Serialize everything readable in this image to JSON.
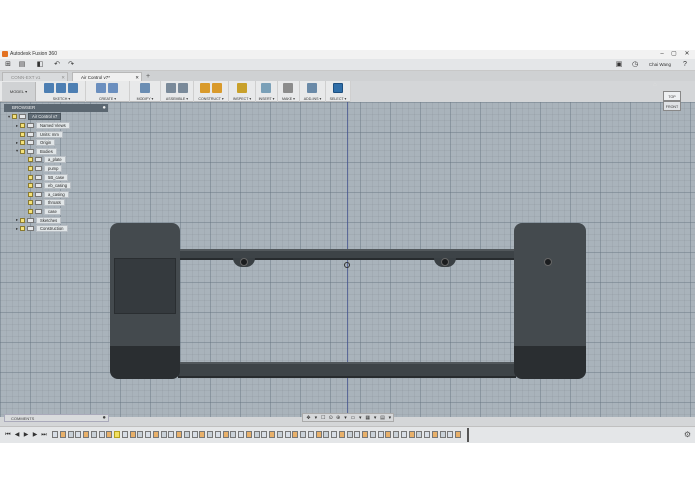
{
  "app": {
    "title": "Autodesk Fusion 360"
  },
  "window_controls": {
    "minimize": "–",
    "maximize": "▢",
    "close": "✕"
  },
  "quick_access": {
    "grid_icon": "⊞",
    "file_icon": "▤",
    "save_icon": "◧",
    "undo_icon": "↶",
    "redo_icon": "↷",
    "user_name": "Chai Wang",
    "help_icon": "?"
  },
  "tabs": [
    {
      "label": "CONN-EXT v1",
      "close": "✕"
    },
    {
      "label": "Air Control v7*",
      "close": "✕"
    }
  ],
  "tab_add": "+",
  "toolbar": {
    "workspace": "MODEL ▾",
    "groups": [
      {
        "label": "SKETCH ▾",
        "color": "#4d7fb3"
      },
      {
        "label": "CREATE ▾",
        "color": "#6b8fbf"
      },
      {
        "label": "MODIFY ▾",
        "color": "#6a8db3"
      },
      {
        "label": "ASSEMBLE ▾",
        "color": "#7a8a9a"
      },
      {
        "label": "CONSTRUCT ▾",
        "color": "#d99a2b"
      },
      {
        "label": "INSPECT ▾",
        "color": "#c8a02a"
      },
      {
        "label": "INSERT ▾",
        "color": "#7aa0b8"
      },
      {
        "label": "MAKE ▾",
        "color": "#8c8c8c"
      },
      {
        "label": "ADD-INS ▾",
        "color": "#6a8aa8"
      },
      {
        "label": "SELECT ▾",
        "color": "#2f6ea8"
      }
    ]
  },
  "browser": {
    "title": "BROWSER",
    "pin_icon": "●",
    "items": [
      {
        "label": "Air Control v7",
        "exp": "▾",
        "indent": 0,
        "type": "root"
      },
      {
        "label": "Named Views",
        "exp": "▸",
        "indent": 1,
        "type": "folder"
      },
      {
        "label": "Units: mm",
        "exp": "",
        "indent": 1,
        "type": "plain"
      },
      {
        "label": "Origin",
        "exp": "▸",
        "indent": 1,
        "type": "folder"
      },
      {
        "label": "Bodies",
        "exp": "▾",
        "indent": 1,
        "type": "folder"
      },
      {
        "label": "a_plate",
        "exp": "",
        "indent": 2,
        "type": "body"
      },
      {
        "label": "pump",
        "exp": "",
        "indent": 2,
        "type": "body"
      },
      {
        "label": "5B_case",
        "exp": "",
        "indent": 2,
        "type": "body"
      },
      {
        "label": "eb_casing",
        "exp": "",
        "indent": 2,
        "type": "body"
      },
      {
        "label": "a_casing",
        "exp": "",
        "indent": 2,
        "type": "body"
      },
      {
        "label": "throats",
        "exp": "",
        "indent": 2,
        "type": "body"
      },
      {
        "label": "case",
        "exp": "",
        "indent": 2,
        "type": "body"
      },
      {
        "label": "Sketches",
        "exp": "▸",
        "indent": 1,
        "type": "folder"
      },
      {
        "label": "Construction",
        "exp": "▸",
        "indent": 1,
        "type": "folder"
      }
    ]
  },
  "viewcube": {
    "top": "TOP",
    "front": "FRONT",
    "home": "⌂"
  },
  "comments": {
    "label": "COMMENTS",
    "pin_icon": "●"
  },
  "navbar": {
    "icons": [
      "✥",
      "▾",
      "☐",
      "⊙",
      "⊕",
      "▾",
      "▭",
      "▾",
      "▦",
      "▾",
      "▤",
      "▾"
    ]
  },
  "timeline": {
    "controls": [
      "⏮",
      "◀",
      "▶",
      "▶",
      "⏭"
    ],
    "feature_count": 56,
    "highlight_index": 8,
    "settings_icon": "⚙"
  }
}
